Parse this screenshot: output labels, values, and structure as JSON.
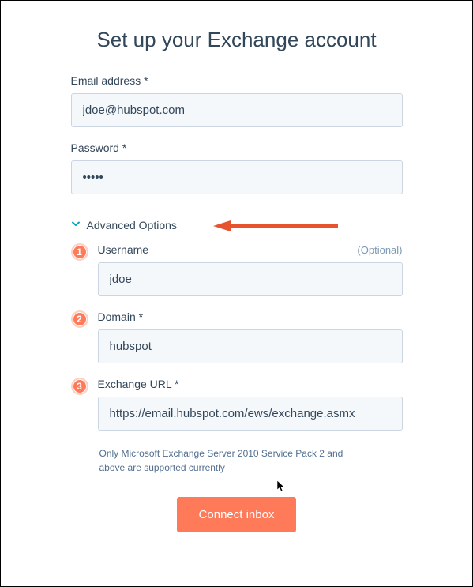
{
  "title": "Set up your Exchange account",
  "fields": {
    "email": {
      "label": "Email address *",
      "value": "jdoe@hubspot.com"
    },
    "password": {
      "label": "Password *",
      "value": "•••••"
    }
  },
  "advanced": {
    "toggle_label": "Advanced Options",
    "username": {
      "badge": "1",
      "label": "Username",
      "optional": "(Optional)",
      "value": "jdoe"
    },
    "domain": {
      "badge": "2",
      "label": "Domain *",
      "value": "hubspot"
    },
    "exchange_url": {
      "badge": "3",
      "label": "Exchange URL *",
      "value": "https://email.hubspot.com/ews/exchange.asmx"
    }
  },
  "help_text": "Only Microsoft Exchange Server 2010 Service Pack 2 and above are supported currently",
  "button": {
    "connect": "Connect inbox"
  }
}
